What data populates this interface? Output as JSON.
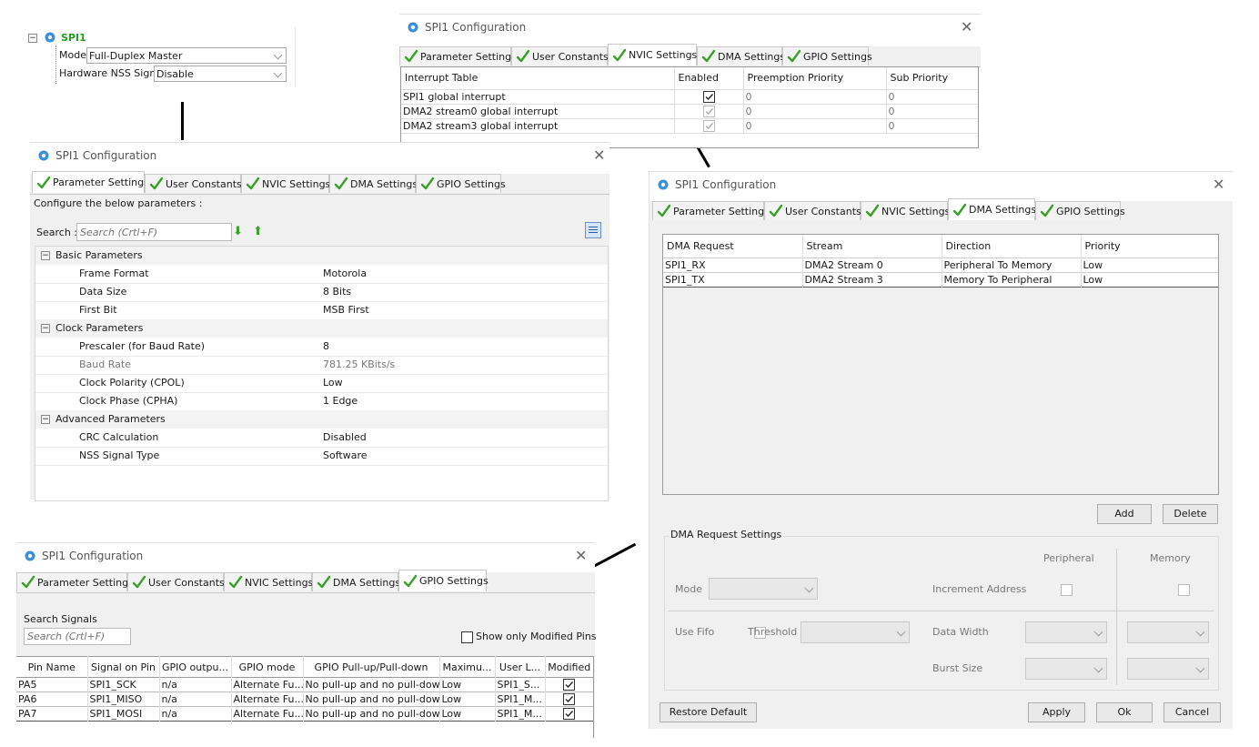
{
  "tree": {
    "node_label": "SPI1",
    "mode_label": "Mode",
    "mode_value": "Full-Duplex Master",
    "nss_label": "Hardware NSS Signal",
    "nss_value": "Disable"
  },
  "window_title": "SPI1 Configuration",
  "tab_labels": [
    "Parameter Settings",
    "User Constants",
    "NVIC Settings",
    "DMA Settings",
    "GPIO Settings"
  ],
  "nvic": {
    "headers": [
      "Interrupt Table",
      "Enabled",
      "Preemption Priority",
      "Sub Priority"
    ],
    "rows": [
      {
        "name": "SPI1 global interrupt",
        "preempt": "0",
        "sub": "0",
        "enabled": true
      },
      {
        "name": "DMA2 stream0 global interrupt",
        "preempt": "0",
        "sub": "0",
        "enabled": true
      },
      {
        "name": "DMA2 stream3 global interrupt",
        "preempt": "0",
        "sub": "0",
        "enabled": true
      }
    ]
  },
  "params": {
    "configure_text": "Configure the below parameters :",
    "search_label": "Search :",
    "search_placeholder": "Search (Crtl+F)",
    "groups": [
      {
        "name": "Basic Parameters",
        "items": [
          {
            "name": "Frame Format",
            "value": "Motorola"
          },
          {
            "name": "Data Size",
            "value": "8 Bits"
          },
          {
            "name": "First Bit",
            "value": "MSB First"
          }
        ]
      },
      {
        "name": "Clock Parameters",
        "items": [
          {
            "name": "Prescaler (for Baud Rate)",
            "value": "8"
          },
          {
            "name": "Baud Rate",
            "value": "781.25 KBits/s"
          },
          {
            "name": "Clock Polarity (CPOL)",
            "value": "Low"
          },
          {
            "name": "Clock Phase (CPHA)",
            "value": "1 Edge"
          }
        ]
      },
      {
        "name": "Advanced Parameters",
        "items": [
          {
            "name": "CRC Calculation",
            "value": "Disabled"
          },
          {
            "name": "NSS Signal Type",
            "value": "Software"
          }
        ]
      }
    ]
  },
  "dma": {
    "headers": [
      "DMA Request",
      "Stream",
      "Direction",
      "Priority"
    ],
    "rows": [
      {
        "request": "SPI1_RX",
        "stream": "DMA2 Stream 0",
        "direction": "Peripheral To Memory",
        "priority": "Low"
      },
      {
        "request": "SPI1_TX",
        "stream": "DMA2 Stream 3",
        "direction": "Memory To Peripheral",
        "priority": "Low"
      }
    ],
    "add_label": "Add",
    "delete_label": "Delete",
    "settings_title": "DMA Request Settings",
    "peripheral_label": "Peripheral",
    "memory_label": "Memory",
    "mode_label": "Mode",
    "increment_label": "Increment Address",
    "fifo_label": "Use Fifo",
    "threshold_label": "Threshold",
    "data_width_label": "Data Width",
    "burst_label": "Burst Size",
    "restore_label": "Restore Default",
    "apply_label": "Apply",
    "ok_label": "Ok",
    "cancel_label": "Cancel"
  },
  "gpio": {
    "search_signals_label": "Search Signals",
    "search_placeholder": "Search (Crtl+F)",
    "show_modified_label": "Show only Modified Pins",
    "headers": [
      "Pin Name",
      "Signal on Pin",
      "GPIO outpu...",
      "GPIO mode",
      "GPIO Pull-up/Pull-down",
      "Maximu...",
      "User L...",
      "Modified"
    ],
    "rows": [
      {
        "pin": "PA5",
        "signal": "SPI1_SCK",
        "output": "n/a",
        "mode": "Alternate Fu...",
        "pull": "No pull-up and no pull-down",
        "max": "Low",
        "user": "SPI1_S...",
        "modified": true
      },
      {
        "pin": "PA6",
        "signal": "SPI1_MISO",
        "output": "n/a",
        "mode": "Alternate Fu...",
        "pull": "No pull-up and no pull-down",
        "max": "Low",
        "user": "SPI1_M...",
        "modified": true
      },
      {
        "pin": "PA7",
        "signal": "SPI1_MOSI",
        "output": "n/a",
        "mode": "Alternate Fu...",
        "pull": "No pull-up and no pull-down",
        "max": "Low",
        "user": "SPI1_M...",
        "modified": true
      }
    ]
  },
  "colors": {
    "check_green": "#3aa02a",
    "node_green": "#21a021",
    "icon_blue": "#3a8fd6",
    "selected_blue": "#cfe3f7"
  }
}
